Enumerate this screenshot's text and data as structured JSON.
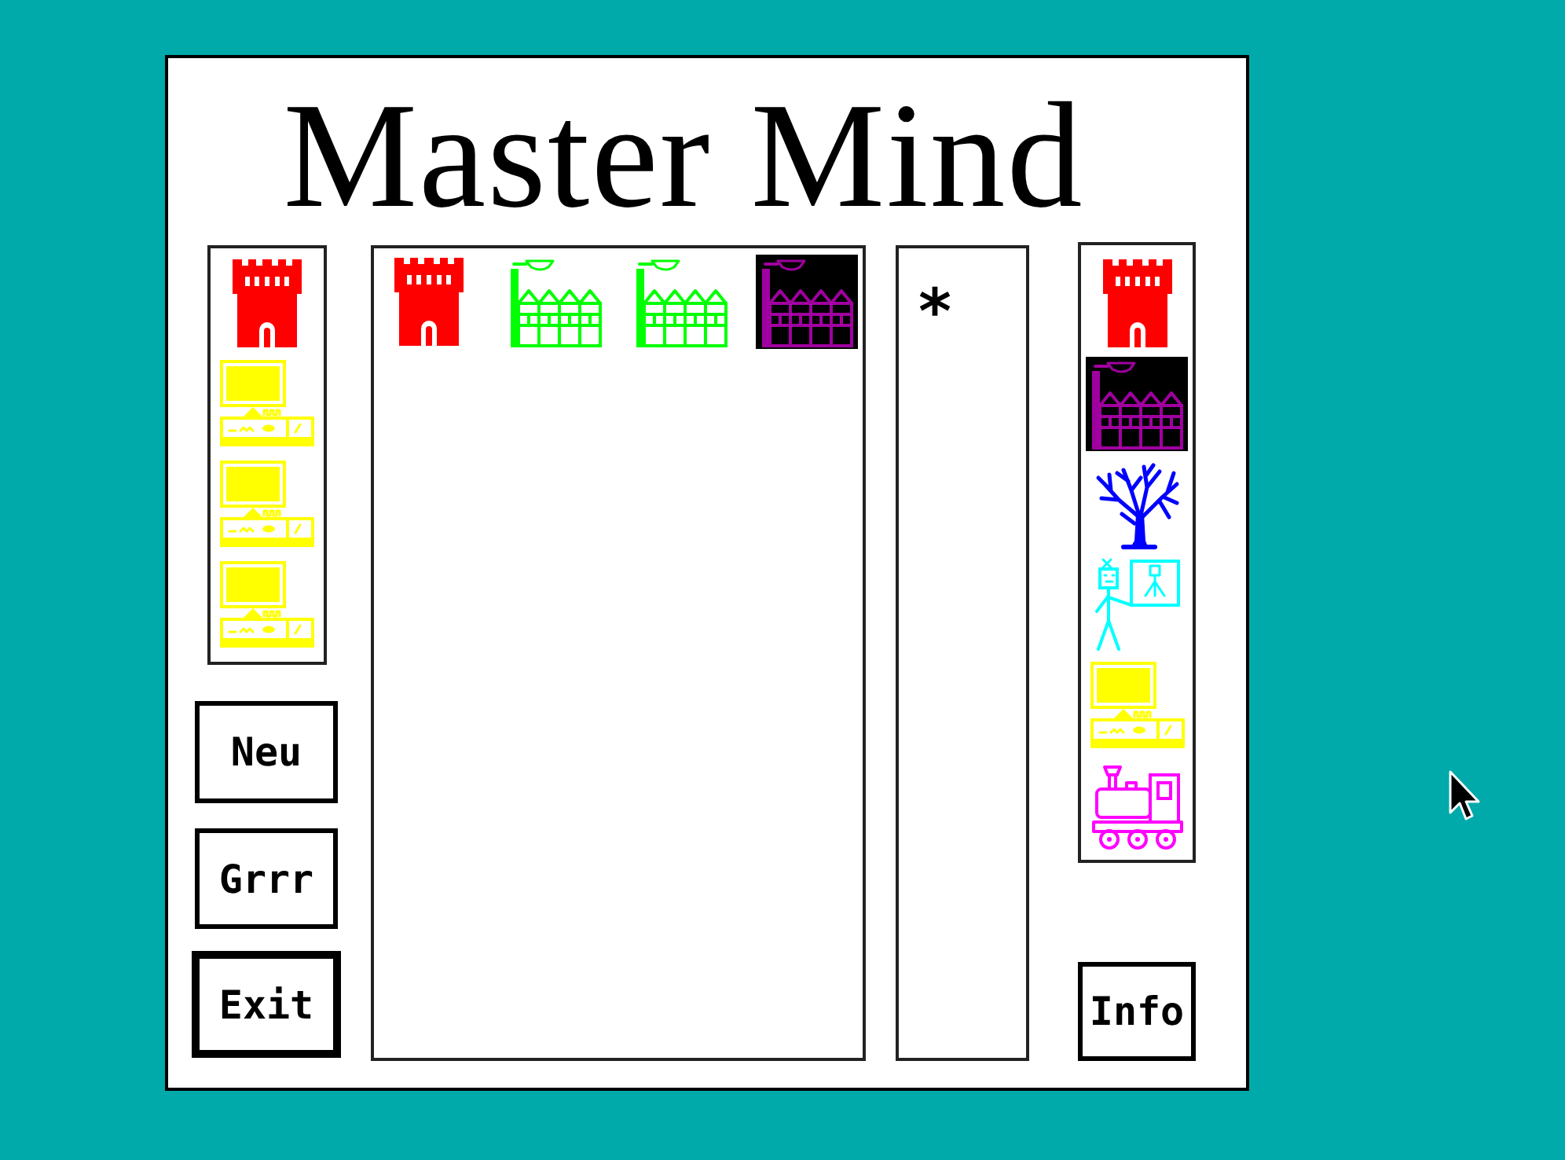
{
  "window": {
    "title": "Master Mind"
  },
  "code_column": {
    "pieces": [
      {
        "kind": "tower",
        "color": "#ff0000",
        "inverted": false
      },
      {
        "kind": "computer",
        "color": "#ffff00",
        "inverted": false
      },
      {
        "kind": "computer",
        "color": "#ffff00",
        "inverted": false
      },
      {
        "kind": "computer",
        "color": "#ffff00",
        "inverted": false
      }
    ]
  },
  "buttons": [
    {
      "label": "Neu",
      "default": false
    },
    {
      "label": "Grrr",
      "default": false
    },
    {
      "label": "Exit",
      "default": true
    }
  ],
  "board": {
    "rows": [
      {
        "pieces": [
          {
            "kind": "tower",
            "color": "#ff0000",
            "inverted": false
          },
          {
            "kind": "factory",
            "color": "#00ff00",
            "inverted": false
          },
          {
            "kind": "factory",
            "color": "#00ff00",
            "inverted": false
          },
          {
            "kind": "factory",
            "color": "#a000a0",
            "inverted": true
          }
        ]
      }
    ]
  },
  "results": {
    "rows": [
      {
        "mark": "*"
      }
    ]
  },
  "palette": {
    "pieces": [
      {
        "kind": "tower",
        "color": "#ff0000",
        "inverted": false
      },
      {
        "kind": "factory",
        "color": "#a000a0",
        "inverted": true
      },
      {
        "kind": "tree",
        "color": "#0000ff",
        "inverted": false
      },
      {
        "kind": "teacher",
        "color": "#00ffff",
        "inverted": false
      },
      {
        "kind": "computer",
        "color": "#ffff00",
        "inverted": false
      },
      {
        "kind": "train",
        "color": "#ff00ff",
        "inverted": false
      }
    ]
  },
  "info_button": {
    "label": "Info"
  }
}
